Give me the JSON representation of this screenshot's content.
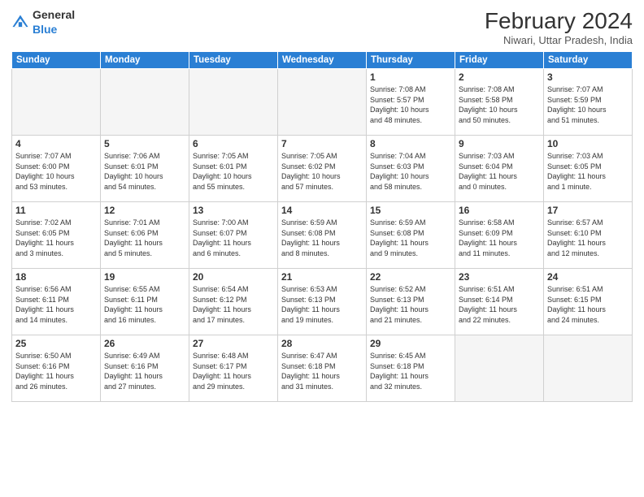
{
  "header": {
    "logo_general": "General",
    "logo_blue": "Blue",
    "month_title": "February 2024",
    "subtitle": "Niwari, Uttar Pradesh, India"
  },
  "days_of_week": [
    "Sunday",
    "Monday",
    "Tuesday",
    "Wednesday",
    "Thursday",
    "Friday",
    "Saturday"
  ],
  "rows": [
    [
      {
        "day": "",
        "text": ""
      },
      {
        "day": "",
        "text": ""
      },
      {
        "day": "",
        "text": ""
      },
      {
        "day": "",
        "text": ""
      },
      {
        "day": "1",
        "text": "Sunrise: 7:08 AM\nSunset: 5:57 PM\nDaylight: 10 hours\nand 48 minutes."
      },
      {
        "day": "2",
        "text": "Sunrise: 7:08 AM\nSunset: 5:58 PM\nDaylight: 10 hours\nand 50 minutes."
      },
      {
        "day": "3",
        "text": "Sunrise: 7:07 AM\nSunset: 5:59 PM\nDaylight: 10 hours\nand 51 minutes."
      }
    ],
    [
      {
        "day": "4",
        "text": "Sunrise: 7:07 AM\nSunset: 6:00 PM\nDaylight: 10 hours\nand 53 minutes."
      },
      {
        "day": "5",
        "text": "Sunrise: 7:06 AM\nSunset: 6:01 PM\nDaylight: 10 hours\nand 54 minutes."
      },
      {
        "day": "6",
        "text": "Sunrise: 7:05 AM\nSunset: 6:01 PM\nDaylight: 10 hours\nand 55 minutes."
      },
      {
        "day": "7",
        "text": "Sunrise: 7:05 AM\nSunset: 6:02 PM\nDaylight: 10 hours\nand 57 minutes."
      },
      {
        "day": "8",
        "text": "Sunrise: 7:04 AM\nSunset: 6:03 PM\nDaylight: 10 hours\nand 58 minutes."
      },
      {
        "day": "9",
        "text": "Sunrise: 7:03 AM\nSunset: 6:04 PM\nDaylight: 11 hours\nand 0 minutes."
      },
      {
        "day": "10",
        "text": "Sunrise: 7:03 AM\nSunset: 6:05 PM\nDaylight: 11 hours\nand 1 minute."
      }
    ],
    [
      {
        "day": "11",
        "text": "Sunrise: 7:02 AM\nSunset: 6:05 PM\nDaylight: 11 hours\nand 3 minutes."
      },
      {
        "day": "12",
        "text": "Sunrise: 7:01 AM\nSunset: 6:06 PM\nDaylight: 11 hours\nand 5 minutes."
      },
      {
        "day": "13",
        "text": "Sunrise: 7:00 AM\nSunset: 6:07 PM\nDaylight: 11 hours\nand 6 minutes."
      },
      {
        "day": "14",
        "text": "Sunrise: 6:59 AM\nSunset: 6:08 PM\nDaylight: 11 hours\nand 8 minutes."
      },
      {
        "day": "15",
        "text": "Sunrise: 6:59 AM\nSunset: 6:08 PM\nDaylight: 11 hours\nand 9 minutes."
      },
      {
        "day": "16",
        "text": "Sunrise: 6:58 AM\nSunset: 6:09 PM\nDaylight: 11 hours\nand 11 minutes."
      },
      {
        "day": "17",
        "text": "Sunrise: 6:57 AM\nSunset: 6:10 PM\nDaylight: 11 hours\nand 12 minutes."
      }
    ],
    [
      {
        "day": "18",
        "text": "Sunrise: 6:56 AM\nSunset: 6:11 PM\nDaylight: 11 hours\nand 14 minutes."
      },
      {
        "day": "19",
        "text": "Sunrise: 6:55 AM\nSunset: 6:11 PM\nDaylight: 11 hours\nand 16 minutes."
      },
      {
        "day": "20",
        "text": "Sunrise: 6:54 AM\nSunset: 6:12 PM\nDaylight: 11 hours\nand 17 minutes."
      },
      {
        "day": "21",
        "text": "Sunrise: 6:53 AM\nSunset: 6:13 PM\nDaylight: 11 hours\nand 19 minutes."
      },
      {
        "day": "22",
        "text": "Sunrise: 6:52 AM\nSunset: 6:13 PM\nDaylight: 11 hours\nand 21 minutes."
      },
      {
        "day": "23",
        "text": "Sunrise: 6:51 AM\nSunset: 6:14 PM\nDaylight: 11 hours\nand 22 minutes."
      },
      {
        "day": "24",
        "text": "Sunrise: 6:51 AM\nSunset: 6:15 PM\nDaylight: 11 hours\nand 24 minutes."
      }
    ],
    [
      {
        "day": "25",
        "text": "Sunrise: 6:50 AM\nSunset: 6:16 PM\nDaylight: 11 hours\nand 26 minutes."
      },
      {
        "day": "26",
        "text": "Sunrise: 6:49 AM\nSunset: 6:16 PM\nDaylight: 11 hours\nand 27 minutes."
      },
      {
        "day": "27",
        "text": "Sunrise: 6:48 AM\nSunset: 6:17 PM\nDaylight: 11 hours\nand 29 minutes."
      },
      {
        "day": "28",
        "text": "Sunrise: 6:47 AM\nSunset: 6:18 PM\nDaylight: 11 hours\nand 31 minutes."
      },
      {
        "day": "29",
        "text": "Sunrise: 6:45 AM\nSunset: 6:18 PM\nDaylight: 11 hours\nand 32 minutes."
      },
      {
        "day": "",
        "text": ""
      },
      {
        "day": "",
        "text": ""
      }
    ]
  ]
}
